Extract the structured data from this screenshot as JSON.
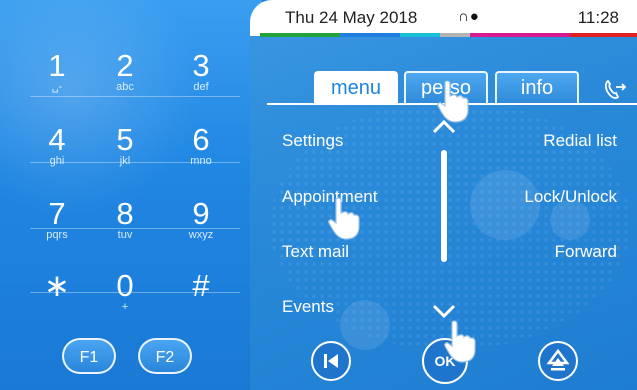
{
  "status": {
    "date": "Thu 24 May 2018",
    "icons": "∩●",
    "time": "11:28",
    "bar_colors": [
      "#22a33a",
      "#1f7fe0",
      "#19c0d8",
      "#b3b3b3",
      "#d81b8c",
      "#e02020"
    ]
  },
  "keypad": {
    "keys": [
      {
        "digit": "1",
        "letters": "␣‑"
      },
      {
        "digit": "2",
        "letters": "abc"
      },
      {
        "digit": "3",
        "letters": "def"
      },
      {
        "digit": "4",
        "letters": "ghi"
      },
      {
        "digit": "5",
        "letters": "jkl"
      },
      {
        "digit": "6",
        "letters": "mno"
      },
      {
        "digit": "7",
        "letters": "pqrs"
      },
      {
        "digit": "8",
        "letters": "tuv"
      },
      {
        "digit": "9",
        "letters": "wxyz"
      },
      {
        "digit": "∗",
        "letters": ""
      },
      {
        "digit": "0",
        "letters": "+"
      },
      {
        "digit": "#",
        "letters": ""
      }
    ],
    "f1": "F1",
    "f2": "F2"
  },
  "tabs": [
    {
      "label": "menu",
      "active": true
    },
    {
      "label": "perso",
      "active": false
    },
    {
      "label": "info",
      "active": false
    }
  ],
  "transfer_icon": "phone-transfer-icon",
  "menu": {
    "left": [
      "Settings",
      "Appointment",
      "Text mail",
      "Events"
    ],
    "right": [
      "Redial list",
      "Lock/Unlock",
      "Forward"
    ]
  },
  "bottom": {
    "ok": "OK"
  }
}
